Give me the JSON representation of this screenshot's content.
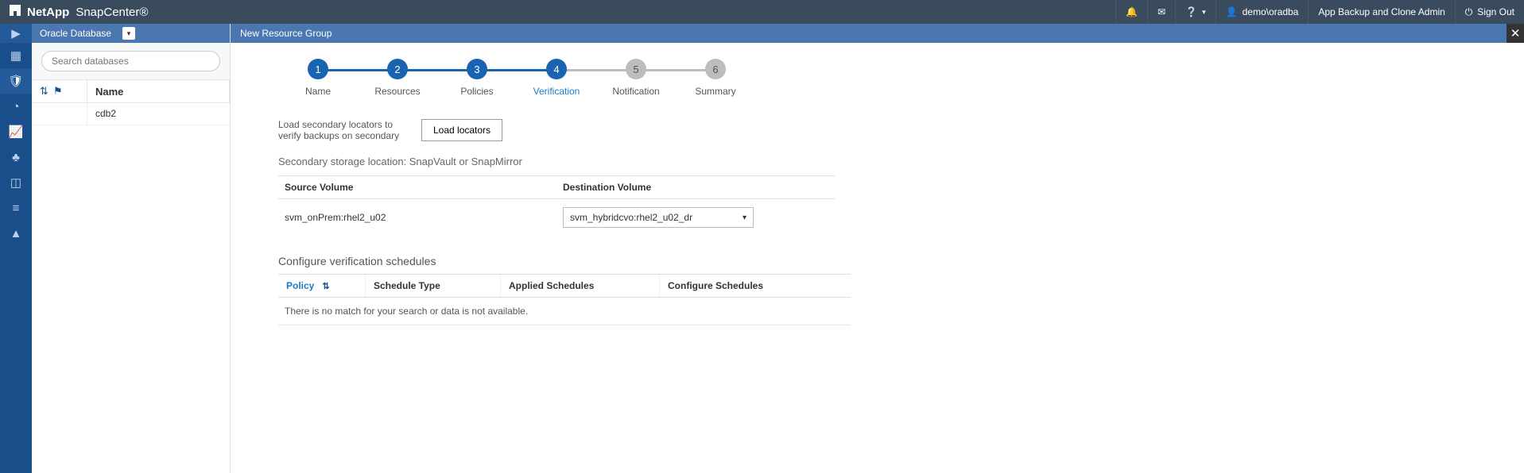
{
  "header": {
    "brand_company": "NetApp",
    "brand_product": "SnapCenter®",
    "user": "demo\\oradba",
    "role": "App Backup and Clone Admin",
    "signout": "Sign Out"
  },
  "sidepanel": {
    "title": "Oracle Database",
    "search_placeholder": "Search databases",
    "name_header": "Name",
    "rows": [
      "cdb2"
    ]
  },
  "content": {
    "title": "New Resource Group"
  },
  "wizard": {
    "steps": [
      {
        "num": "1",
        "label": "Name",
        "state": "done"
      },
      {
        "num": "2",
        "label": "Resources",
        "state": "done"
      },
      {
        "num": "3",
        "label": "Policies",
        "state": "done"
      },
      {
        "num": "4",
        "label": "Verification",
        "state": "active"
      },
      {
        "num": "5",
        "label": "Notification",
        "state": "pending"
      },
      {
        "num": "6",
        "label": "Summary",
        "state": "pending"
      }
    ]
  },
  "verification": {
    "load_label": "Load secondary locators to verify backups on secondary",
    "load_button": "Load locators",
    "storage_heading": "Secondary storage location: SnapVault or SnapMirror",
    "col_source": "Source Volume",
    "col_dest": "Destination Volume",
    "source_value": "svm_onPrem:rhel2_u02",
    "dest_value": "svm_hybridcvo:rhel2_u02_dr",
    "sched_heading": "Configure verification schedules",
    "sched_cols": {
      "policy": "Policy",
      "type": "Schedule Type",
      "applied": "Applied Schedules",
      "configure": "Configure Schedules"
    },
    "empty": "There is no match for your search or data is not available."
  }
}
